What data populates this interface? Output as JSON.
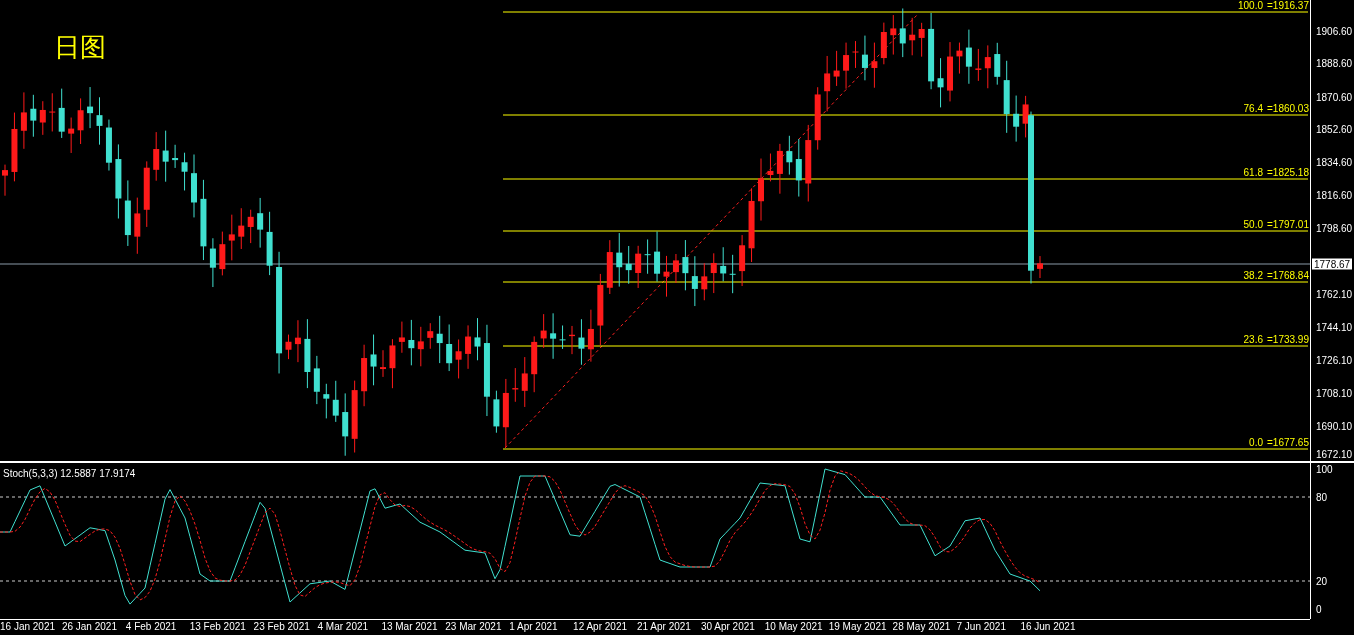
{
  "chart": {
    "label": "日图",
    "current_price": "1778.67",
    "price_axis": [
      "1906.60",
      "1888.60",
      "1870.60",
      "1852.60",
      "1834.60",
      "1816.60",
      "1798.60",
      "1762.10",
      "1744.10",
      "1726.10",
      "1708.10",
      "1690.10",
      "1672.10"
    ],
    "fib_levels": [
      {
        "ratio": "100.0",
        "price": "=1916.37"
      },
      {
        "ratio": "76.4",
        "price": "=1860.03"
      },
      {
        "ratio": "61.8",
        "price": "=1825.18"
      },
      {
        "ratio": "50.0",
        "price": "=1797.01"
      },
      {
        "ratio": "38.2",
        "price": "=1768.84"
      },
      {
        "ratio": "23.6",
        "price": "=1733.99"
      },
      {
        "ratio": "0.0",
        "price": "=1677.65"
      }
    ]
  },
  "indicator": {
    "label": "Stoch(5,3,3) 12.5887 17.9174",
    "axis": [
      "100",
      "80",
      "20",
      "0"
    ]
  },
  "date_axis": [
    "16 Jan 2021",
    "26 Jan 2021",
    "4 Feb 2021",
    "13 Feb 2021",
    "23 Feb 2021",
    "4 Mar 2021",
    "13 Mar 2021",
    "23 Mar 2021",
    "1 Apr 2021",
    "12 Apr 2021",
    "21 Apr 2021",
    "30 Apr 2021",
    "10 May 2021",
    "19 May 2021",
    "28 May 2021",
    "7 Jun 2021",
    "16 Jun 2021"
  ]
}
